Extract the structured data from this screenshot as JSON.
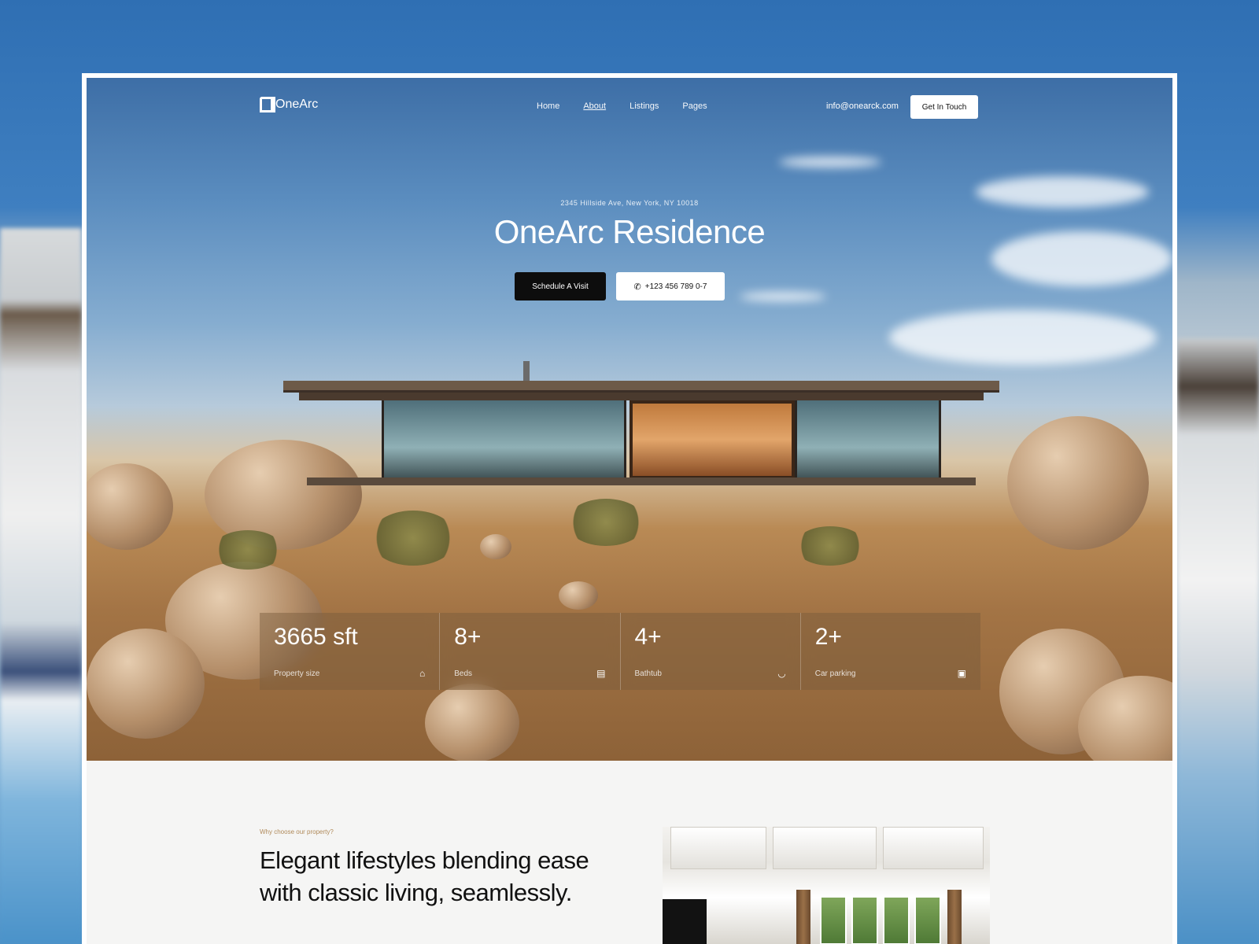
{
  "nav": {
    "brand": "OneArc",
    "links": [
      "Home",
      "About",
      "Listings",
      "Pages"
    ],
    "email": "info@onearck.com",
    "cta_label": "Get In Touch"
  },
  "hero": {
    "address": "2345 Hillside Ave, New York, NY 10018",
    "title": "OneArc Residence",
    "primary_button": "Schedule A Visit",
    "phone_button": "+123 456 789 0-7",
    "stats": [
      {
        "value": "3665 sft",
        "label": "Property size",
        "icon": "home-icon"
      },
      {
        "value": "8+",
        "label": "Beds",
        "icon": "bed-icon"
      },
      {
        "value": "4+",
        "label": "Bathtub",
        "icon": "bath-icon"
      },
      {
        "value": "2+",
        "label": "Car parking",
        "icon": "car-icon"
      }
    ]
  },
  "about": {
    "eyebrow": "Why choose our property?",
    "heading": "Elegant lifestyles blending ease with classic living, seamlessly."
  },
  "colors": {
    "sky": "#5b8dbf",
    "desert": "#b98a55",
    "button_dark": "#0d0d0d",
    "accent": "#b08a5a"
  }
}
